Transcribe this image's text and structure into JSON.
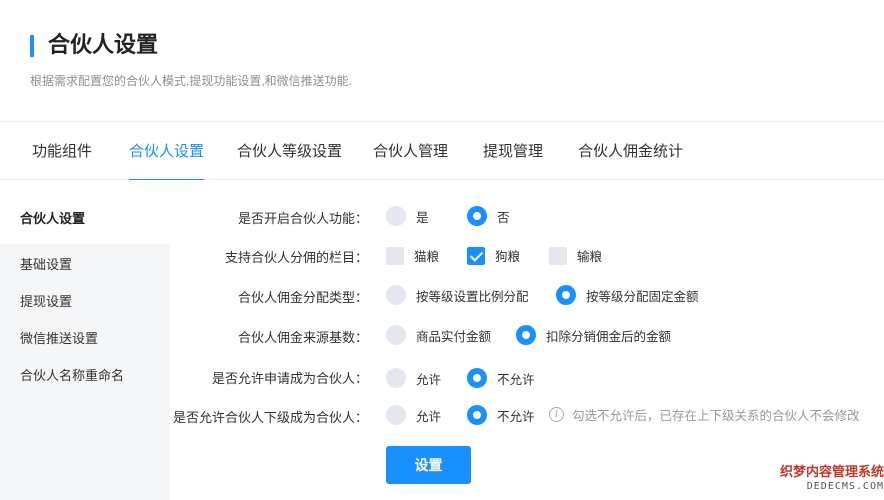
{
  "header": {
    "title": "合伙人设置",
    "subtitle": "根据需求配置您的合伙人模式,提现功能设置,和微信推送功能."
  },
  "tabs": [
    {
      "label": "功能组件",
      "active": false
    },
    {
      "label": "合伙人设置",
      "active": true
    },
    {
      "label": "合伙人等级设置",
      "active": false
    },
    {
      "label": "合伙人管理",
      "active": false
    },
    {
      "label": "提现管理",
      "active": false
    },
    {
      "label": "合伙人佣金统计",
      "active": false
    }
  ],
  "sidebar": {
    "heading": "合伙人设置",
    "items": [
      "基础设置",
      "提现设置",
      "微信推送设置",
      "合伙人名称重命名"
    ]
  },
  "form": {
    "rows": [
      {
        "label": "是否开启合伙人功能：",
        "options": [
          {
            "label": "是",
            "checked": false
          },
          {
            "label": "否",
            "checked": true
          }
        ]
      },
      {
        "label": "支持合伙人分佣的栏目：",
        "options": [
          {
            "label": "猫粮",
            "checked": false
          },
          {
            "label": "狗粮",
            "checked": true
          },
          {
            "label": "输粮",
            "checked": false
          }
        ]
      },
      {
        "label": "合伙人佣金分配类型：",
        "options": [
          {
            "label": "按等级设置比例分配",
            "checked": false
          },
          {
            "label": "按等级分配固定金额",
            "checked": true
          }
        ]
      },
      {
        "label": "合伙人佣金来源基数：",
        "options": [
          {
            "label": "商品实付金额",
            "checked": false
          },
          {
            "label": "扣除分销佣金后的金额",
            "checked": true
          }
        ]
      },
      {
        "label": "是否允许申请成为合伙人：",
        "options": [
          {
            "label": "允许",
            "checked": false
          },
          {
            "label": "不允许",
            "checked": true
          }
        ]
      },
      {
        "label": "是否允许合伙人下级成为合伙人：",
        "options": [
          {
            "label": "允许",
            "checked": false
          },
          {
            "label": "不允许",
            "checked": true
          }
        ]
      }
    ],
    "hint": "勾选不允许后，已存在上下级关系的合伙人不会修改",
    "hint_icon": "info-icon",
    "submit_label": "设置"
  },
  "watermark": {
    "line1": "织梦内容管理系统",
    "line2": "DEDECMS.COM"
  },
  "colors": {
    "accent": "#1890ff",
    "unchecked": "#e4e7ed"
  }
}
